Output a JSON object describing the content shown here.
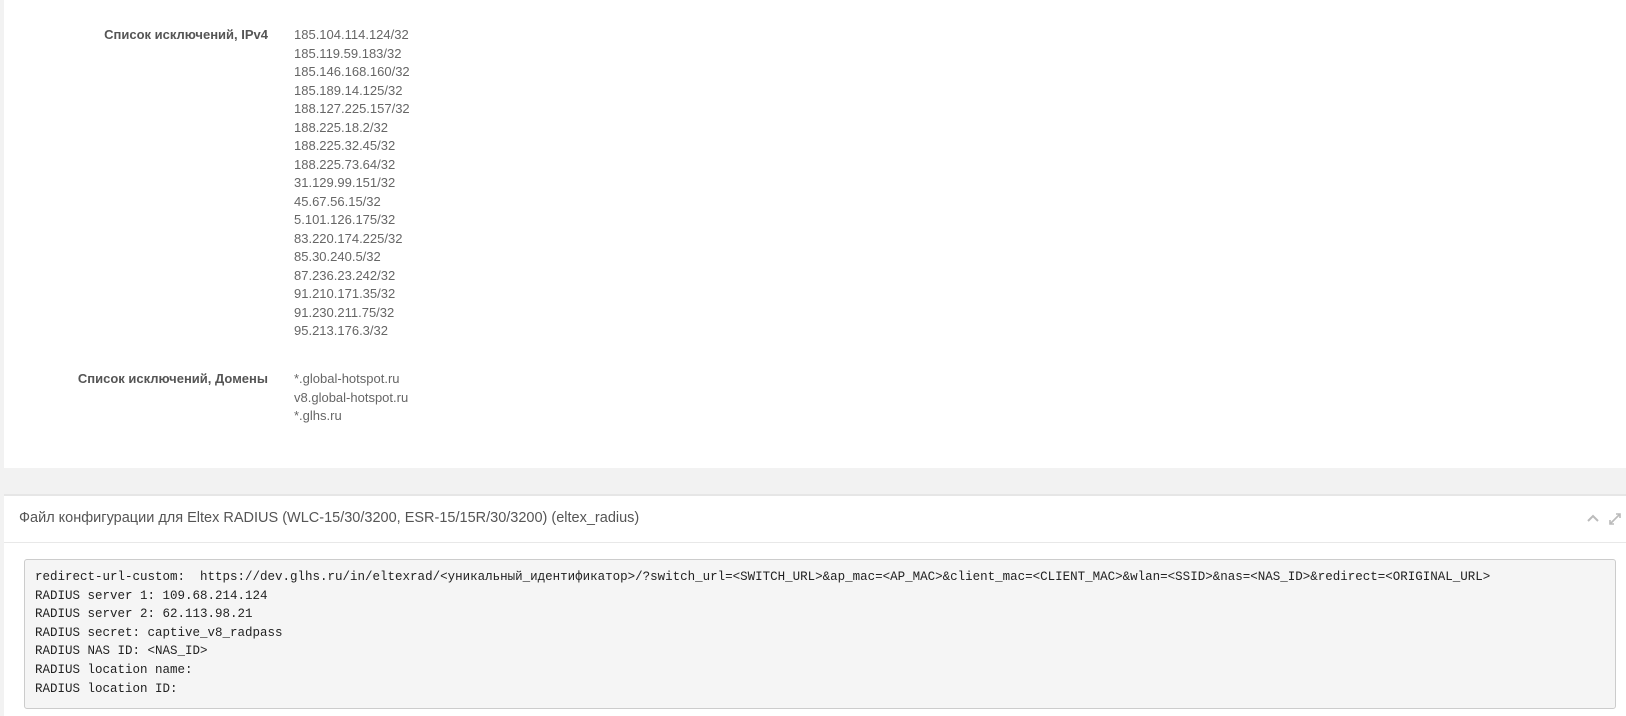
{
  "ipv4_section": {
    "label": "Список исключений, IPv4",
    "items": [
      "185.104.114.124/32",
      "185.119.59.183/32",
      "185.146.168.160/32",
      "185.189.14.125/32",
      "188.127.225.157/32",
      "188.225.18.2/32",
      "188.225.32.45/32",
      "188.225.73.64/32",
      "31.129.99.151/32",
      "45.67.56.15/32",
      "5.101.126.175/32",
      "83.220.174.225/32",
      "85.30.240.5/32",
      "87.236.23.242/32",
      "91.210.171.35/32",
      "91.230.211.75/32",
      "95.213.176.3/32"
    ]
  },
  "domains_section": {
    "label": "Список исключений, Домены",
    "items": [
      "*.global-hotspot.ru",
      "v8.global-hotspot.ru",
      "*.glhs.ru"
    ]
  },
  "config_panel": {
    "title": "Файл конфигурации для Eltex RADIUS (WLC-15/30/3200, ESR-15/15R/30/3200) (eltex_radius)",
    "icons": [
      "chevron-up-icon",
      "expand-icon"
    ],
    "lines": [
      "redirect-url-custom:  https://dev.glhs.ru/in/eltexrad/<уникальный_идентификатор>/?switch_url=<SWITCH_URL>&ap_mac=<AP_MAC>&client_mac=<CLIENT_MAC>&wlan=<SSID>&nas=<NAS_ID>&redirect=<ORIGINAL_URL>",
      "RADIUS server 1: 109.68.214.124",
      "RADIUS server 2: 62.113.98.21",
      "RADIUS secret: captive_v8_radpass",
      "RADIUS NAS ID: <NAS_ID>",
      "RADIUS location name:",
      "RADIUS location ID:"
    ]
  }
}
